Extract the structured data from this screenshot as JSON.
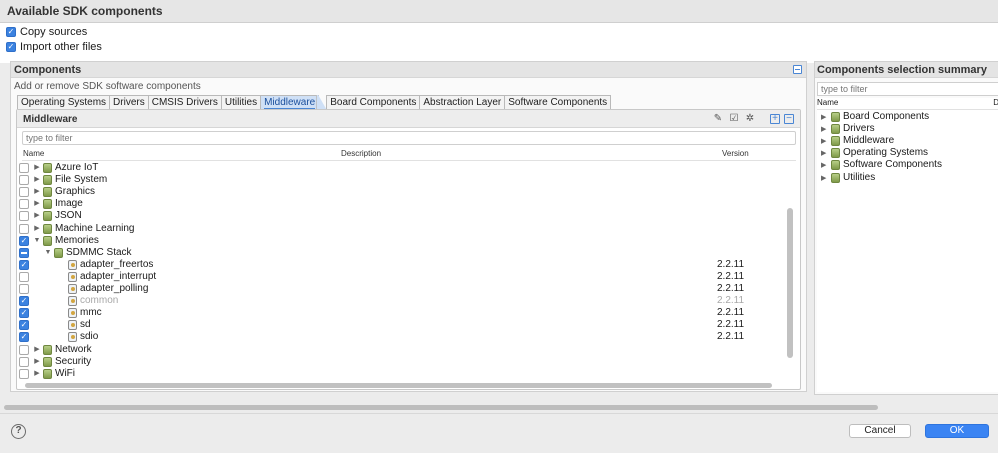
{
  "window": {
    "title": "Available SDK components"
  },
  "options": [
    {
      "label": "Copy sources",
      "checked": true
    },
    {
      "label": "Import other files",
      "checked": true
    }
  ],
  "components": {
    "header": "Components",
    "subtitle": "Add or remove SDK software components",
    "tabs": [
      "Operating Systems",
      "Drivers",
      "CMSIS Drivers",
      "Utilities",
      "Middleware",
      "Board Components",
      "Abstraction Layer",
      "Software Components"
    ],
    "active_tab": "Middleware",
    "inner_title": "Middleware",
    "filter_placeholder": "type to filter",
    "columns": {
      "name": "Name",
      "description": "Description",
      "version": "Version"
    },
    "rows": [
      {
        "name": "Azure IoT",
        "version": "",
        "state": "off",
        "level": 0,
        "expand": "collapsed",
        "icon": "database-icon"
      },
      {
        "name": "File System",
        "version": "",
        "state": "off",
        "level": 0,
        "expand": "collapsed",
        "icon": "database-icon"
      },
      {
        "name": "Graphics",
        "version": "",
        "state": "off",
        "level": 0,
        "expand": "collapsed",
        "icon": "database-icon"
      },
      {
        "name": "Image",
        "version": "",
        "state": "off",
        "level": 0,
        "expand": "collapsed",
        "icon": "database-icon"
      },
      {
        "name": "JSON",
        "version": "",
        "state": "off",
        "level": 0,
        "expand": "collapsed",
        "icon": "database-icon"
      },
      {
        "name": "Machine Learning",
        "version": "",
        "state": "off",
        "level": 0,
        "expand": "collapsed",
        "icon": "database-icon"
      },
      {
        "name": "Memories",
        "version": "",
        "state": "on",
        "level": 0,
        "expand": "expanded",
        "icon": "database-icon"
      },
      {
        "name": "SDMMC Stack",
        "version": "",
        "state": "partial",
        "level": 1,
        "expand": "expanded",
        "icon": "database-icon"
      },
      {
        "name": "adapter_freertos",
        "version": "2.2.11",
        "state": "on",
        "level": 2,
        "expand": "none",
        "icon": "component-icon"
      },
      {
        "name": "adapter_interrupt",
        "version": "2.2.11",
        "state": "off",
        "level": 2,
        "expand": "none",
        "icon": "component-icon"
      },
      {
        "name": "adapter_polling",
        "version": "2.2.11",
        "state": "off",
        "level": 2,
        "expand": "none",
        "icon": "component-icon"
      },
      {
        "name": "common",
        "version": "2.2.11",
        "state": "on",
        "level": 2,
        "expand": "none",
        "icon": "component-icon",
        "dim": true
      },
      {
        "name": "mmc",
        "version": "2.2.11",
        "state": "on",
        "level": 2,
        "expand": "none",
        "icon": "component-icon"
      },
      {
        "name": "sd",
        "version": "2.2.11",
        "state": "on",
        "level": 2,
        "expand": "none",
        "icon": "component-icon"
      },
      {
        "name": "sdio",
        "version": "2.2.11",
        "state": "on",
        "level": 2,
        "expand": "none",
        "icon": "component-icon"
      },
      {
        "name": "Network",
        "version": "",
        "state": "off",
        "level": 0,
        "expand": "collapsed",
        "icon": "database-icon"
      },
      {
        "name": "Security",
        "version": "",
        "state": "off",
        "level": 0,
        "expand": "collapsed",
        "icon": "database-icon"
      },
      {
        "name": "WiFi",
        "version": "",
        "state": "off",
        "level": 0,
        "expand": "collapsed",
        "icon": "database-icon"
      }
    ]
  },
  "summary": {
    "header": "Components selection summary",
    "filter_placeholder": "type to filter",
    "column_name": "Name",
    "column_desc_truncated": "D",
    "items": [
      "Board Components",
      "Drivers",
      "Middleware",
      "Operating Systems",
      "Software Components",
      "Utilities"
    ]
  },
  "buttons": {
    "help": "?",
    "cancel": "Cancel",
    "ok": "OK"
  },
  "colors": {
    "accent": "#3a84f3",
    "checkbox": "#3b82e0",
    "dim_text": "#a8a8a8"
  }
}
